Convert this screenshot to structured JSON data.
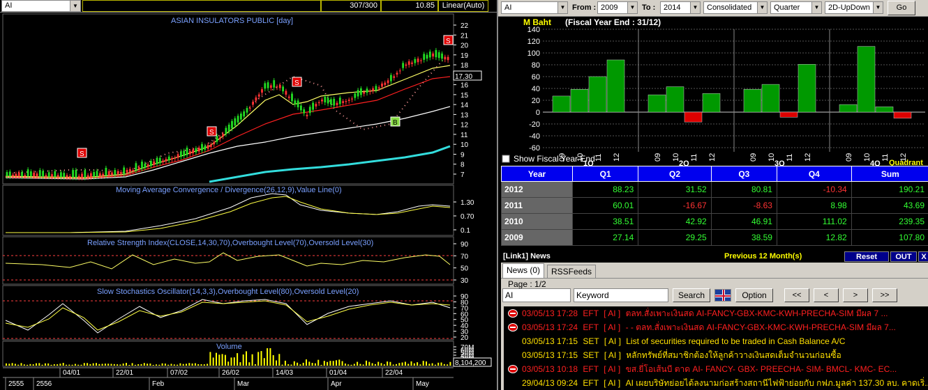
{
  "left": {
    "symbol": "AI",
    "header_count": "307/300",
    "header_price": "10.85",
    "scale_mode": "Linear(Auto)",
    "price_title": "ASIAN INSULATORS PUBLIC [day]",
    "current_price": "17.30",
    "price_axis": [
      "22",
      "21",
      "20",
      "19",
      "18",
      "17",
      "16",
      "15",
      "14",
      "13",
      "12",
      "11",
      "10",
      "9",
      "8",
      "7"
    ],
    "macd_title": "Moving Average Convergence / Divergence(26,12,9),Value Line(0)",
    "macd_axis": [
      "1.30",
      "0.70",
      "0.1"
    ],
    "rsi_title": "Relative Strength Index(CLOSE,14,30,70),Overbought Level(70),Oversold Level(30)",
    "rsi_axis": [
      "90",
      "70",
      "50",
      "30"
    ],
    "stoch_title": "Slow Stochastics Oscillator(14,3,3),Overbought Level(80),Oversold Level(20)",
    "stoch_axis": [
      "90",
      "80",
      "70",
      "60",
      "50",
      "40",
      "30",
      "20"
    ],
    "volume_title": "Volume",
    "volume_axis": [
      "70M",
      "60M",
      "50M",
      "40M",
      "30M",
      "20M",
      "10M"
    ],
    "volume_current": "8,104,200",
    "date_labels": [
      "04/01",
      "22/01",
      "07/02",
      "26/02",
      "14/03",
      "01/04",
      "22/04"
    ],
    "month_labels": [
      "2555",
      "2556",
      "Feb",
      "Mar",
      "Apr",
      "May"
    ],
    "signal_sell": "S",
    "signal_buy": "B"
  },
  "right": {
    "symbol": "AI",
    "from_label": "From :",
    "from_year": "2009",
    "to_label": "To :",
    "to_year": "2014",
    "consolidated": "Consolidated",
    "period": "Quarter",
    "view": "2D-UpDown",
    "go_label": "Go",
    "chart_unit": "M Baht",
    "fiscal_note": "(Fiscal Year End : 31/12)",
    "show_fiscal_label": "Show Fiscal Year End",
    "quadrant_label": "Quadrant",
    "table": {
      "headers": [
        "Year",
        "Q1",
        "Q2",
        "Q3",
        "Q4",
        "Sum"
      ],
      "rows": [
        {
          "year": "2012",
          "q1": "88.23",
          "q2": "31.52",
          "q3": "80.81",
          "q4": "-10.34",
          "sum": "190.21"
        },
        {
          "year": "2011",
          "q1": "60.01",
          "q2": "-16.67",
          "q3": "-8.63",
          "q4": "8.98",
          "sum": "43.69"
        },
        {
          "year": "2010",
          "q1": "38.51",
          "q2": "42.92",
          "q3": "46.91",
          "q4": "111.02",
          "sum": "239.35"
        },
        {
          "year": "2009",
          "q1": "27.14",
          "q2": "29.25",
          "q3": "38.59",
          "q4": "12.82",
          "sum": "107.80"
        }
      ]
    },
    "news": {
      "title": "[Link1] News",
      "previous_label": "Previous 12 Month(s)",
      "reset_label": "Reset",
      "out_label": "OUT",
      "close_label": "X",
      "tab_news": "News (0)",
      "tab_rss": "RSSFeeds",
      "page_label": "Page : 1/2",
      "search_symbol": "AI",
      "keyword_placeholder": "Keyword",
      "search_label": "Search",
      "option_label": "Option",
      "nav_first": "<<",
      "nav_prev": "<",
      "nav_next": ">",
      "nav_last": ">>",
      "items": [
        {
          "date": "03/05/13 17:28",
          "src": "EFT",
          "sym": "[ AI ]",
          "text": "ตลท.สั่งเพาะเงินสด AI-FANCY-GBX-KMC-KWH-PRECHA-SIM มีผล 7 ...",
          "color": "red",
          "icon": true
        },
        {
          "date": "03/05/13 17:24",
          "src": "EFT",
          "sym": "[ AI ]",
          "text": "- - ตลท.สั่งเพาะเงินสด AI-FANCY-GBX-KMC-KWH-PRECHA-SIM มีผล 7...",
          "color": "red",
          "icon": true
        },
        {
          "date": "03/05/13 17:15",
          "src": "SET",
          "sym": "[ AI ]",
          "text": "List of securities required to be traded in Cash Balance A/C",
          "color": "yel",
          "icon": false
        },
        {
          "date": "03/05/13 17:15",
          "src": "SET",
          "sym": "[ AI ]",
          "text": "หลักทรัพย์ที่สมาชิกต้องให้ลูกค้าวางเงินสดเต็มจำนวนก่อนซื้อ",
          "color": "yel",
          "icon": false
        },
        {
          "date": "03/05/13 10:18",
          "src": "EFT",
          "sym": "[ AI ]",
          "text": "ขส.ยี่โอเส้นบี ตาด AI- FANCY- GBX- PREECHA- SIM- BMCL- KMC- EC...",
          "color": "red",
          "icon": true
        },
        {
          "date": "29/04/13 09:24",
          "src": "EFT",
          "sym": "[ AI ]",
          "text": "AI เผยบริษัทย่อยได้ลงนามก่อสร้างสถานีไฟฟ้าย่อยกับ กฟภ.มูลค่า 137.30 ลบ. คาดเริ่...",
          "color": "yel",
          "icon": false
        }
      ]
    }
  },
  "chart_data": {
    "type": "bar",
    "title": "",
    "ylabel": "M Baht",
    "ylim": [
      -60,
      140
    ],
    "yticks": [
      140,
      120,
      100,
      80,
      60,
      40,
      20,
      0,
      -20,
      -40,
      -60
    ],
    "groups": [
      {
        "label": "1Q",
        "bars": [
          {
            "year": "09",
            "value": 27.14
          },
          {
            "year": "10",
            "value": 38.51
          },
          {
            "year": "11",
            "value": 60.01
          },
          {
            "year": "12",
            "value": 88.23
          }
        ]
      },
      {
        "label": "2Q",
        "bars": [
          {
            "year": "09",
            "value": 29.25
          },
          {
            "year": "10",
            "value": 42.92
          },
          {
            "year": "11",
            "value": -16.67
          },
          {
            "year": "12",
            "value": 31.52
          }
        ]
      },
      {
        "label": "3Q",
        "bars": [
          {
            "year": "09",
            "value": 38.59
          },
          {
            "year": "10",
            "value": 46.91
          },
          {
            "year": "11",
            "value": -8.63
          },
          {
            "year": "12",
            "value": 80.81
          }
        ]
      },
      {
        "label": "4Q",
        "bars": [
          {
            "year": "09",
            "value": 12.82
          },
          {
            "year": "10",
            "value": 111.02
          },
          {
            "year": "11",
            "value": 8.98
          },
          {
            "year": "12",
            "value": -10.34
          }
        ]
      }
    ],
    "grid": true,
    "positive_color": "#009900",
    "negative_color": "#dd0000"
  }
}
